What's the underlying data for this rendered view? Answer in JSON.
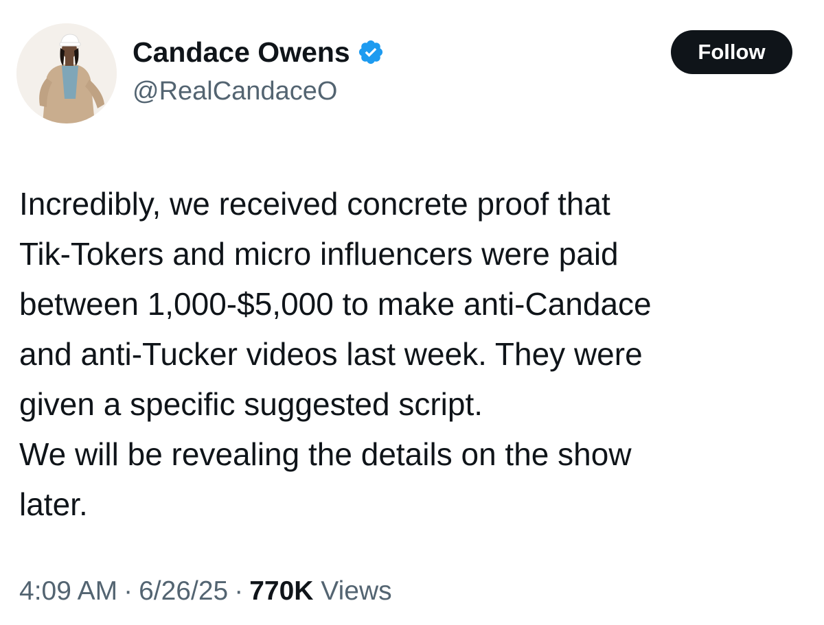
{
  "author": {
    "display_name": "Candace Owens",
    "handle": "@RealCandaceO",
    "verified": true,
    "verified_color": "#1d9bf0"
  },
  "actions": {
    "follow_label": "Follow"
  },
  "tweet": {
    "lines": [
      "Incredibly, we received concrete proof that",
      "Tik-Tokers and micro influencers were paid",
      "between 1,000-$5,000 to make anti-Candace",
      "and anti-Tucker videos last week. They were",
      "given a specific suggested script.",
      "We will be revealing the details on the show",
      "later."
    ]
  },
  "meta": {
    "time": "4:09 AM",
    "separator": "·",
    "date": "6/26/25",
    "views_count": "770K",
    "views_label": "Views"
  }
}
